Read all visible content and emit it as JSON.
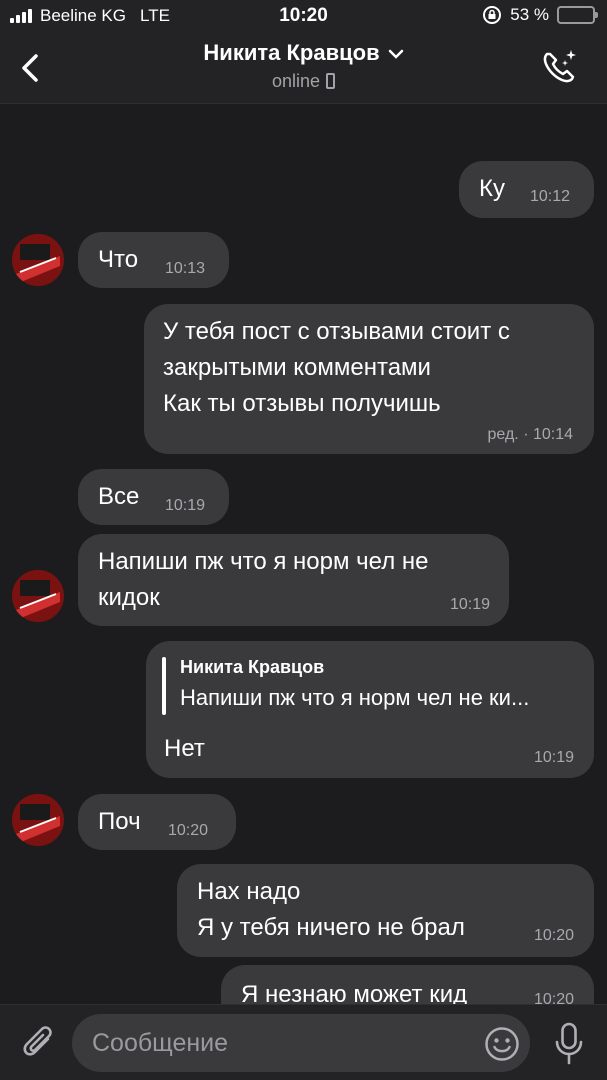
{
  "status_bar": {
    "carrier": "Beeline KG",
    "network": "LTE",
    "time": "10:20",
    "battery": "53 %",
    "battery_level": 0.53
  },
  "header": {
    "contact_name": "Никита Кравцов",
    "status": "online"
  },
  "messages": [
    {
      "text": "Ку",
      "time": "10:12"
    },
    {
      "text": "Что",
      "time": "10:13"
    },
    {
      "lines": [
        "У тебя пост с отзывами стоит с",
        "закрытыми комментами",
        "Как ты отзывы получишь"
      ],
      "time": "ред. · 10:14"
    },
    {
      "text": "Все",
      "time": "10:19"
    },
    {
      "lines": [
        "Напиши пж что я норм чел не",
        "кидок"
      ],
      "time": "10:19"
    },
    {
      "reply_name": "Никита Кравцов",
      "reply_text": "Напиши пж что я норм чел не ки...",
      "text": "Нет",
      "time": "10:19"
    },
    {
      "text": "Поч",
      "time": "10:20"
    },
    {
      "lines": [
        "Нах надо",
        "Я у тебя ничего не брал"
      ],
      "time": "10:20"
    },
    {
      "text": "Я незнаю может кид",
      "time": "10:20"
    }
  ],
  "input": {
    "placeholder": "Сообщение"
  },
  "colors": {
    "background": "#1c1c1e",
    "bar": "#232325",
    "bubble": "#3a3a3c",
    "battery": "#4cd964"
  },
  "icons": [
    "back-arrow-icon",
    "chevron-down-icon",
    "call-icon",
    "attach-icon",
    "emoji-icon",
    "mic-icon"
  ]
}
